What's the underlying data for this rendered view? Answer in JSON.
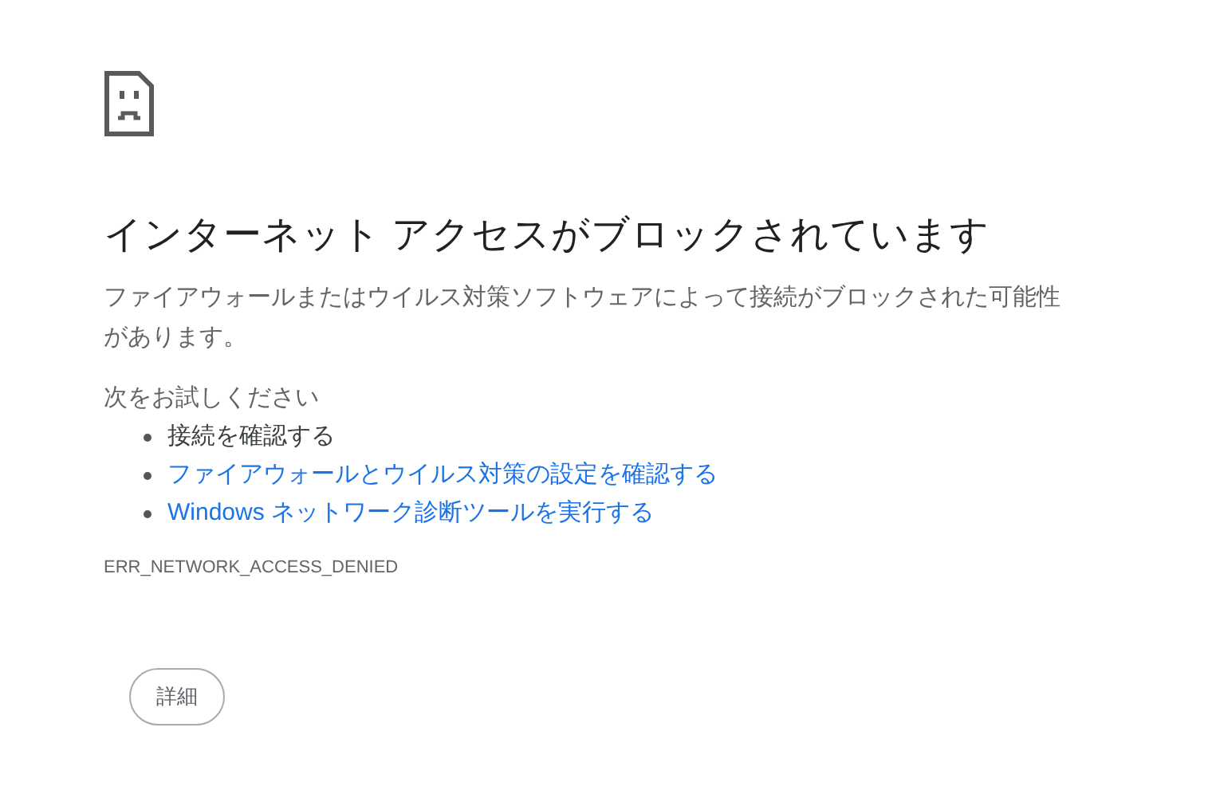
{
  "heading": "インターネット アクセスがブロックされています",
  "message": "ファイアウォールまたはウイルス対策ソフトウェアによって接続がブロックされた可能性があります。",
  "suggestions_title": "次をお試しください",
  "suggestions": [
    {
      "kind": "text",
      "label": "接続を確認する"
    },
    {
      "kind": "link",
      "label": "ファイアウォールとウイルス対策の設定を確認する"
    },
    {
      "kind": "link",
      "label": "Windows ネットワーク診断ツールを実行する"
    }
  ],
  "error_code": "ERR_NETWORK_ACCESS_DENIED",
  "details_button": "詳細"
}
